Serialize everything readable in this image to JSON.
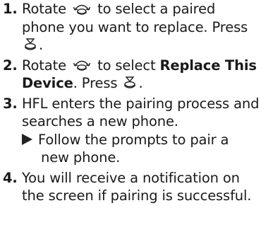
{
  "steps": [
    {
      "number": "1.",
      "line1_pre": "Rotate",
      "line1_post": "to select a paired",
      "line2": "phone you want to replace. Press",
      "line3_post": ".",
      "knob_icon": "knob-rotate-icon",
      "press_icon": "knob-press-icon"
    },
    {
      "number": "2.",
      "line1_pre": "Rotate",
      "line1_mid": "to select",
      "line1_bold": "Replace This",
      "line2_bold": "Device",
      "line2_post": ". Press",
      "line2_end": ".",
      "knob_icon": "knob-rotate-icon",
      "press_icon": "knob-press-icon"
    },
    {
      "number": "3.",
      "line1": "HFL enters the pairing process and",
      "line2": "searches a new phone.",
      "sub_line1": "Follow the prompts to pair a",
      "sub_line2": "new phone.",
      "sub_icon": "triangle-right-icon"
    },
    {
      "number": "4.",
      "line1": "You will receive a notification on",
      "line2": "the screen if pairing is successful."
    }
  ]
}
